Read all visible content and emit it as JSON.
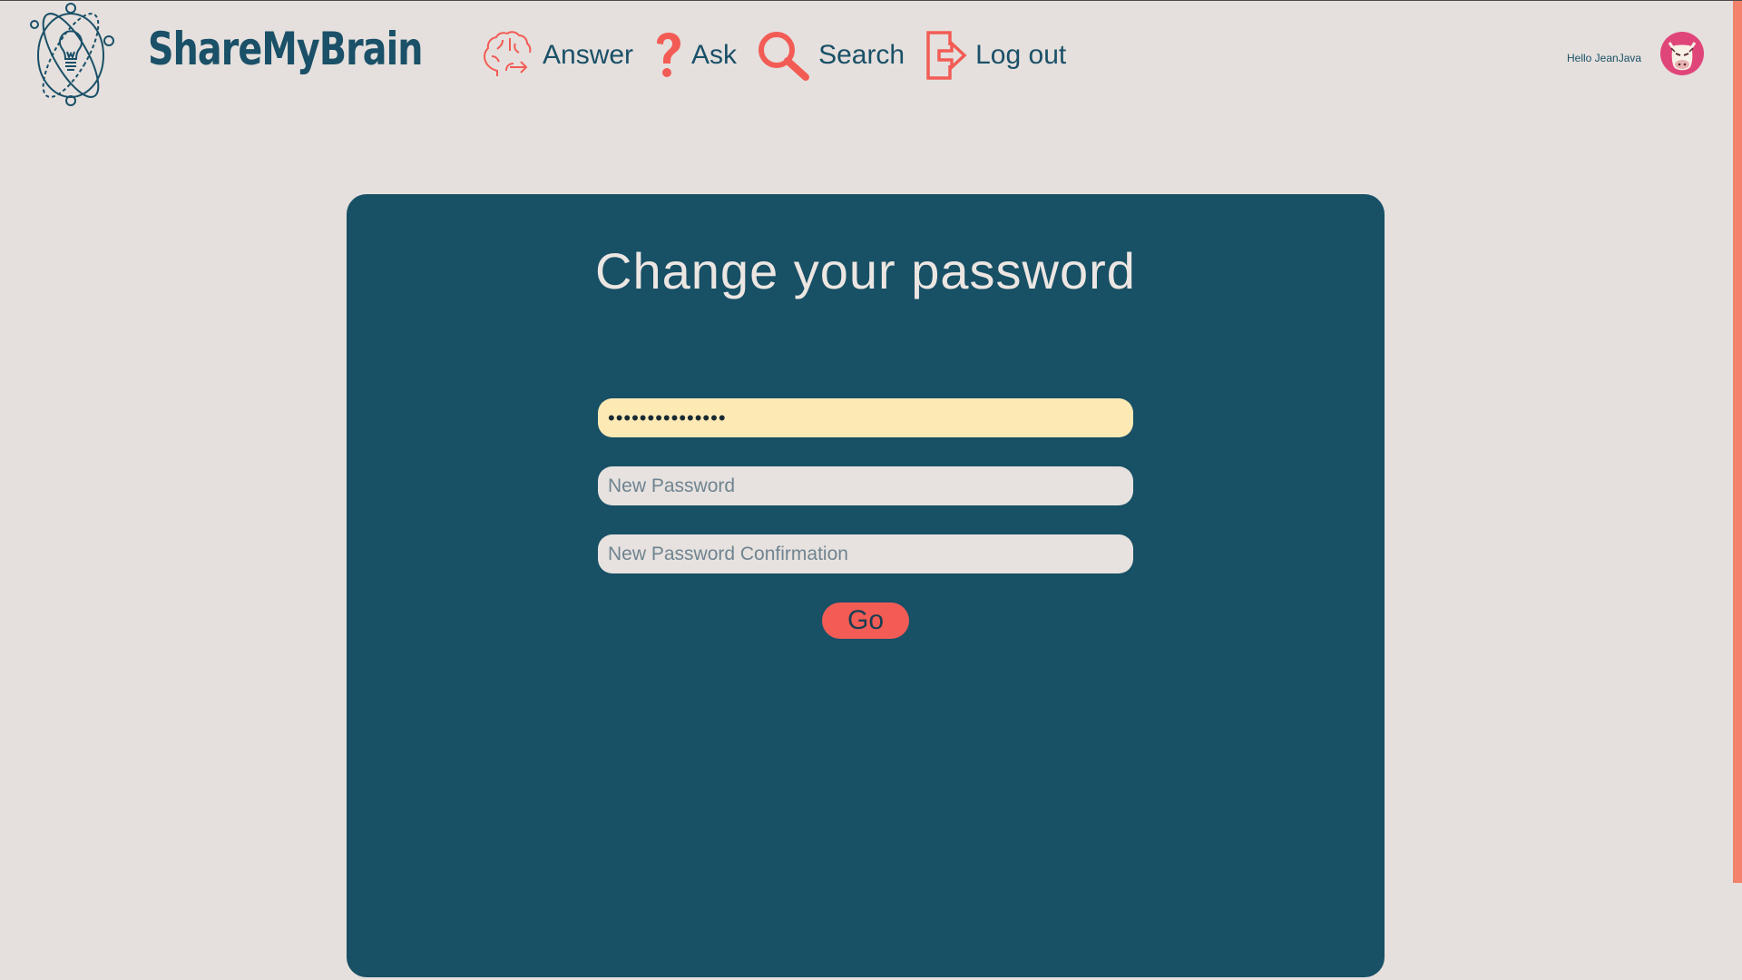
{
  "header": {
    "brand": "ShareMyBrain",
    "nav": [
      {
        "label": "Answer",
        "icon": "brain-icon"
      },
      {
        "label": "Ask",
        "icon": "question-mark-icon"
      },
      {
        "label": "Search",
        "icon": "magnifier-icon"
      },
      {
        "label": "Log out",
        "icon": "logout-icon"
      }
    ],
    "greeting": "Hello JeanJava"
  },
  "form": {
    "title": "Change your password",
    "current_password_value": "•••••••••••••••",
    "new_password_placeholder": "New Password",
    "confirm_placeholder": "New Password Confirmation",
    "submit_label": "Go"
  },
  "colors": {
    "brand": "#1a5068",
    "accent": "#f25c55",
    "card": "#185066",
    "background": "#e5e0dd",
    "autofill": "#fde9b4"
  }
}
